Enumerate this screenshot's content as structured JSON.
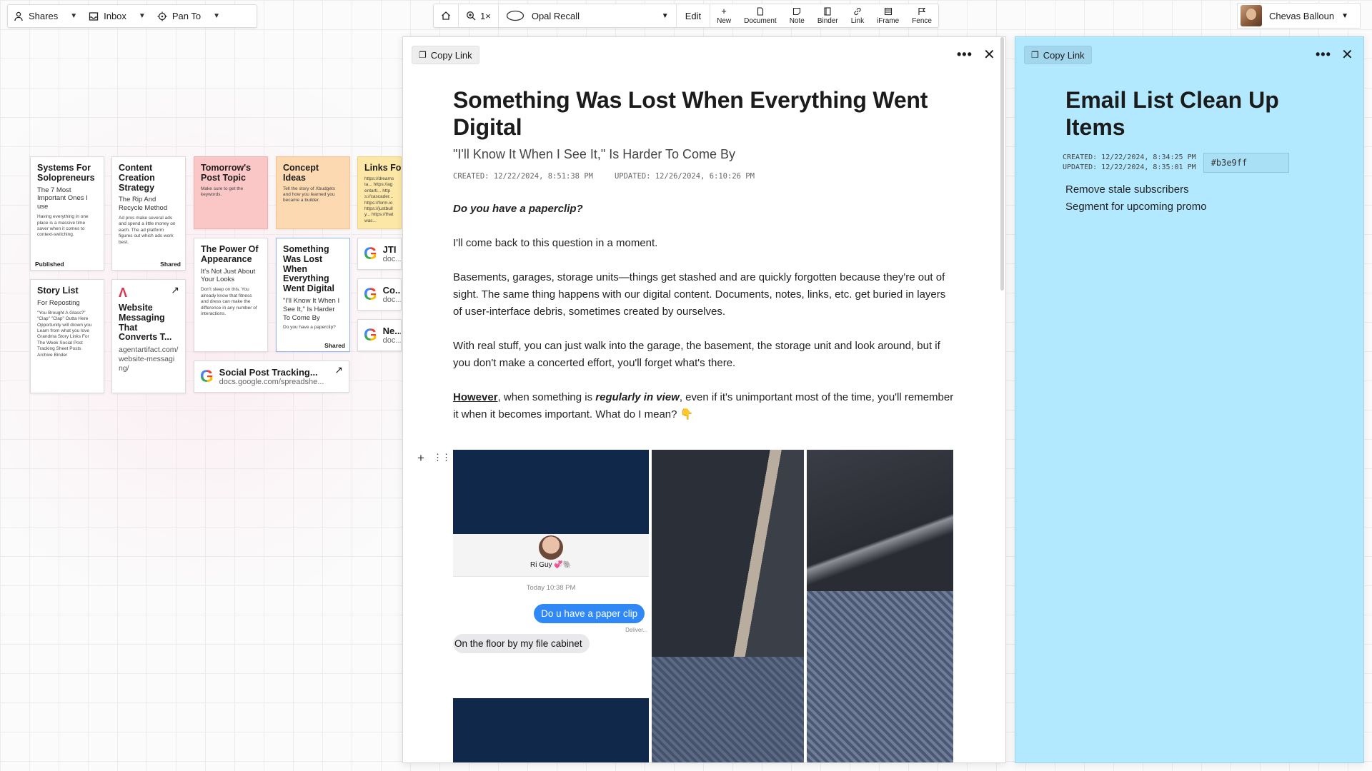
{
  "toolbar_left": {
    "shares": "Shares",
    "inbox": "Inbox",
    "pan_to": "Pan To"
  },
  "toolbar_center": {
    "zoom": "1×",
    "workspace": "Opal Recall",
    "edit": "Edit",
    "tools": [
      "New",
      "Document",
      "Note",
      "Binder",
      "Link",
      "iFrame",
      "Fence"
    ]
  },
  "user": {
    "name": "Chevas Balloun"
  },
  "canvas_cards": [
    {
      "title": "Systems For Solopreneurs",
      "subtitle": "The 7 Most Important Ones I use",
      "body": "Having everything in one place is a massive time saver when it comes to context-switching.",
      "footer": "Published",
      "bg": "#ffffff"
    },
    {
      "title": "Content Creation Strategy",
      "subtitle": "The Rip And Recycle Method",
      "body": "Ad pros make several ads and spend a little money on each. The ad platform figures out which ads work best.",
      "footer": "Shared",
      "bg": "#ffffff"
    },
    {
      "title": "Tomorrow's Post Topic",
      "subtitle": "",
      "body": "Make sure to get the keywords.",
      "footer": "",
      "bg": "#fbc6c6"
    },
    {
      "title": "Concept Ideas",
      "subtitle": "",
      "body": "Tell the story of Xbudgets and how you learned you became a builder.",
      "footer": "",
      "bg": "#fcd9b0"
    },
    {
      "title": "Links For The Week",
      "subtitle": "",
      "body": "https://dreamsta... https://agentarti... https://cascader... https://form.io https://justbully... https://thatwas...",
      "footer": "",
      "bg": "#fde7a6"
    },
    {
      "title": "Story List",
      "subtitle": "For Reposting",
      "body": "\"You Brought A Glass?\" \"Clap\" \"Clap\" Outta Here Opportunity will drown you Learn from what you love Grandma Story Links For The Week Social Post Tracking Sheet Posts Archive Binder",
      "footer": "",
      "bg": "#ffffff"
    },
    {
      "title": "Website Messaging That Converts T...",
      "subtitle": "",
      "body": "agentartifact.com/website-messaging/",
      "footer": "",
      "bg": "#ffffff"
    },
    {
      "title": "The Power Of Appearance",
      "subtitle": "It's Not Just About Your Looks",
      "body": "Don't sleep on this. You already know that fitness and dress can make the difference in any number of interactions.",
      "footer": "",
      "bg": "#ffffff"
    },
    {
      "title": "Something Was Lost When Everything Went Digital",
      "subtitle": "\"I'll Know It When I See It,\" Is Harder To Come By",
      "body": "Do you have a paperclip?",
      "footer": "Shared",
      "bg": "#ffffff"
    }
  ],
  "google_cards": [
    {
      "title": "JTI",
      "url": "doc..."
    },
    {
      "title": "Co...",
      "url": "doc..."
    },
    {
      "title": "Ne...",
      "url": "doc..."
    },
    {
      "title": "Social Post Tracking...",
      "url": "docs.google.com/spreadshe..."
    }
  ],
  "document": {
    "copy_link": "Copy Link",
    "title": "Something Was Lost When Everything Went Digital",
    "subtitle": "\"I'll Know It When I See It,\" Is Harder To Come By",
    "created": "CREATED: 12/22/2024, 8:51:38 PM",
    "updated": "UPDATED: 12/26/2024, 6:10:26 PM",
    "question": "Do you have a paperclip?",
    "p1": "I'll come back to this question in a moment.",
    "p2": "Basements, garages, storage units—things get stashed and are quickly forgotten because they're out of sight. The same thing happens with our digital content. Documents, notes, links, etc. get buried in layers of user-interface debris, sometimes created by ourselves.",
    "p3": "With real stuff, you can just walk into the garage, the basement, the storage unit and look around, but if you don't make a concerted effort, you'll forget what's there.",
    "p4_a": "However",
    "p4_b": ", when something is ",
    "p4_c": "regularly in view",
    "p4_d": ", even if it's unimportant most of the time, you'll remember it when it becomes important. What do I mean? 👇",
    "chat": {
      "contact": "Ri Guy 💞🐘",
      "time": "Today 10:38 PM",
      "sent": "Do u have a paper clip",
      "delivered": "Deliver...",
      "received": "On the floor by my file cabinet"
    }
  },
  "note": {
    "copy_link": "Copy Link",
    "title": "Email List Clean Up Items",
    "created": "CREATED: 12/22/2024, 8:34:25 PM",
    "updated": "UPDATED: 12/22/2024, 8:35:01 PM",
    "color": "#b3e9ff",
    "items": [
      "Remove stale subscribers",
      "Segment for upcoming promo"
    ]
  },
  "icons": [
    "person-icon",
    "inbox-icon",
    "crosshair-icon",
    "home-icon",
    "zoom-icon",
    "workspace-icon",
    "plus-icon",
    "document-icon",
    "note-icon",
    "binder-icon",
    "link-icon",
    "iframe-icon",
    "fence-icon",
    "copy-icon",
    "more-icon",
    "close-icon",
    "external-link-icon",
    "google-icon",
    "drag-handle-icon"
  ]
}
